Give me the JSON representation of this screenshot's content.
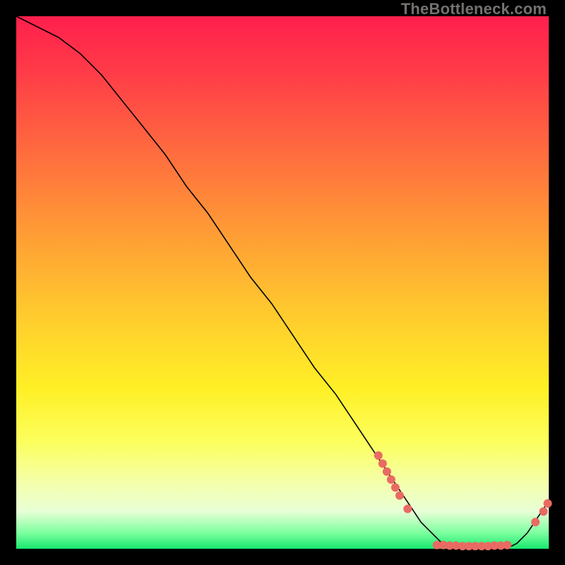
{
  "watermark": "TheBottleneck.com",
  "colors": {
    "dot": "#e96a63",
    "curve": "#000000",
    "bg": "#000000"
  },
  "chart_data": {
    "type": "line",
    "title": "",
    "xlabel": "",
    "ylabel": "",
    "xlim": [
      0,
      100
    ],
    "ylim": [
      0,
      100
    ],
    "series": [
      {
        "name": "bottleneck-curve",
        "x": [
          0,
          4,
          8,
          12,
          16,
          20,
          24,
          28,
          32,
          36,
          40,
          44,
          48,
          52,
          56,
          60,
          64,
          68,
          72,
          74,
          76,
          78,
          80,
          82,
          84,
          86,
          88,
          90,
          92,
          94,
          96,
          98,
          100
        ],
        "y": [
          100,
          98,
          96,
          93,
          89,
          84,
          79,
          74,
          68,
          63,
          57,
          51,
          46,
          40,
          34,
          29,
          23,
          17,
          11,
          8,
          5,
          3,
          1,
          0,
          0,
          0,
          0,
          0,
          0,
          1,
          3,
          6,
          9
        ]
      }
    ],
    "points": [
      {
        "x": 68.0,
        "y": 17.5
      },
      {
        "x": 68.8,
        "y": 16.0
      },
      {
        "x": 69.6,
        "y": 14.5
      },
      {
        "x": 70.4,
        "y": 13.0
      },
      {
        "x": 71.2,
        "y": 11.5
      },
      {
        "x": 72.0,
        "y": 10.0
      },
      {
        "x": 73.5,
        "y": 7.5
      },
      {
        "x": 79.0,
        "y": 0.7
      },
      {
        "x": 80.2,
        "y": 0.7
      },
      {
        "x": 81.4,
        "y": 0.6
      },
      {
        "x": 82.6,
        "y": 0.6
      },
      {
        "x": 83.8,
        "y": 0.5
      },
      {
        "x": 85.0,
        "y": 0.5
      },
      {
        "x": 86.2,
        "y": 0.5
      },
      {
        "x": 87.4,
        "y": 0.5
      },
      {
        "x": 88.6,
        "y": 0.5
      },
      {
        "x": 89.8,
        "y": 0.6
      },
      {
        "x": 91.0,
        "y": 0.6
      },
      {
        "x": 92.2,
        "y": 0.7
      },
      {
        "x": 97.5,
        "y": 5.0
      },
      {
        "x": 99.0,
        "y": 7.0
      },
      {
        "x": 99.8,
        "y": 8.5
      }
    ]
  }
}
